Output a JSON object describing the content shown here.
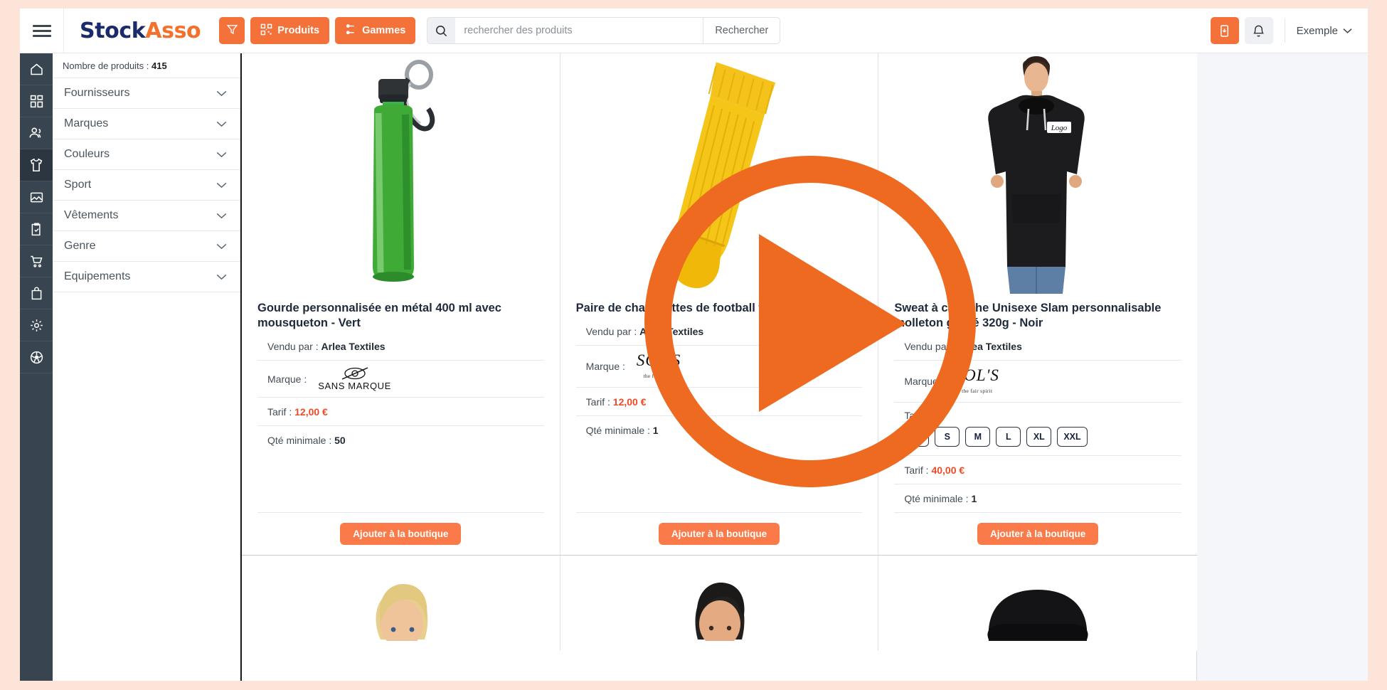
{
  "app": {
    "brand_part1": "Stock",
    "brand_part2": "Asso",
    "user_label": "Exemple"
  },
  "topbar": {
    "menu_icon": "hamburger-icon",
    "filter_button_icon": "funnel-icon",
    "produits_label": "Produits",
    "produits_icon": "qr-code-icon",
    "gammes_label": "Gammes",
    "gammes_icon": "nodes-icon",
    "search_icon": "search-icon",
    "search_placeholder": "rechercher des produits",
    "search_value": "",
    "search_button_label": "Rechercher",
    "export_icon": "device-download-icon",
    "bell_icon": "bell-icon",
    "user_chevron_icon": "chevron-down-icon"
  },
  "rail": {
    "items": [
      {
        "name": "home-icon",
        "active": false
      },
      {
        "name": "dashboard-grid-icon",
        "active": false
      },
      {
        "name": "users-icon",
        "active": false
      },
      {
        "name": "tshirt-icon",
        "active": true
      },
      {
        "name": "image-icon",
        "active": false
      },
      {
        "name": "clipboard-check-icon",
        "active": false
      },
      {
        "name": "shopping-cart-icon",
        "active": false
      },
      {
        "name": "shopping-bag-icon",
        "active": false
      },
      {
        "name": "gear-icon",
        "active": false
      },
      {
        "name": "soccer-ball-icon",
        "active": false
      }
    ]
  },
  "filters": {
    "count_label": "Nombre de produits : ",
    "count_value": "415",
    "items": [
      {
        "label": "Fournisseurs"
      },
      {
        "label": "Marques"
      },
      {
        "label": "Couleurs"
      },
      {
        "label": "Sport"
      },
      {
        "label": "Vêtements"
      },
      {
        "label": "Genre"
      },
      {
        "label": "Equipements"
      }
    ],
    "chevron": "⌄"
  },
  "products": [
    {
      "title": "Gourde personnalisée en métal 400 ml avec mousqueton - Vert",
      "seller_label": "Vendu par : ",
      "seller": "Arlea Textiles",
      "brand_label": "Marque : ",
      "brand_logo": "sans-marque",
      "brand_logo_text": "SANS MARQUE",
      "price_label": "Tarif : ",
      "price": "12,00 €",
      "qty_label": "Qté minimale : ",
      "qty": "50",
      "sizes": [],
      "add_label": "Ajouter à la boutique",
      "image": "green-metal-bottle"
    },
    {
      "title": "Paire de chaussettes de football taille unique",
      "seller_label": "Vendu par : ",
      "seller": "Arlea Textiles",
      "brand_label": "Marque : ",
      "brand_logo": "sols",
      "brand_logo_text": "SOL'S",
      "price_label": "Tarif : ",
      "price": "12,00 €",
      "qty_label": "Qté minimale : ",
      "qty": "1",
      "sizes": [],
      "add_label": "Ajouter à la boutique",
      "image": "yellow-football-sock"
    },
    {
      "title": "Sweat à capuche Unisexe Slam personnalisable molleton gratté 320g - Noir",
      "seller_label": "Vendu par : ",
      "seller": "Arlea Textiles",
      "brand_label": "Marque : ",
      "brand_logo": "sols",
      "brand_logo_text": "SOL'S",
      "size_label": "Taille :",
      "sizes": [
        "XS",
        "S",
        "M",
        "L",
        "XL",
        "XXL"
      ],
      "price_label": "Tarif : ",
      "price": "40,00 €",
      "qty_label": "Qté minimale : ",
      "qty": "1",
      "add_label": "Ajouter à la boutique",
      "image": "black-hoodie-model"
    }
  ],
  "overlay": {
    "play_icon": "play-button-overlay",
    "color": "#ef6a21"
  },
  "colors": {
    "accent": "#f4713a",
    "brand_dark": "#1b2a6b",
    "price": "#ee4a26",
    "rail": "#384551",
    "page_bg": "#fce5d8"
  }
}
